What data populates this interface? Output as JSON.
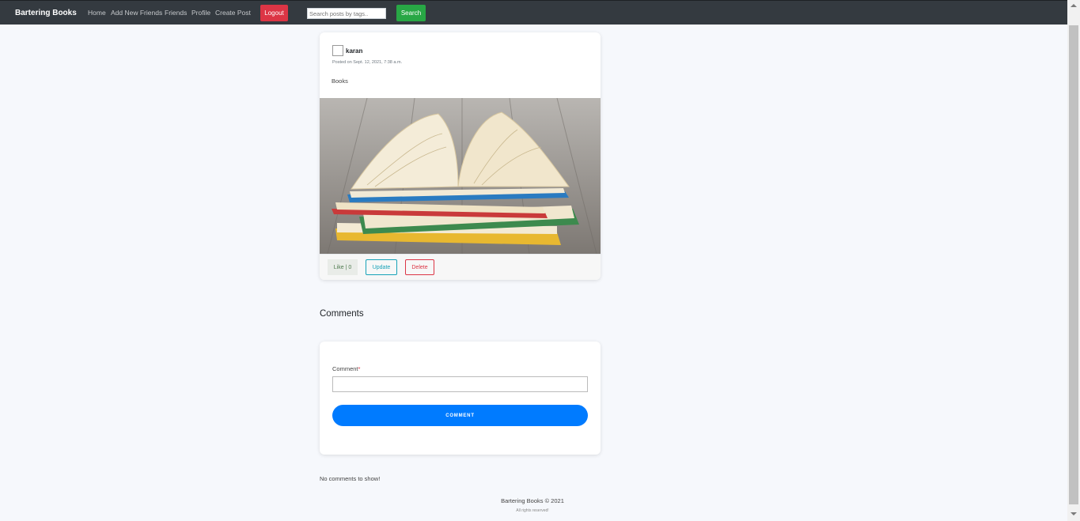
{
  "navbar": {
    "brand": "Bartering Books",
    "links": [
      "Home",
      "Add New Friends",
      "Friends",
      "Profile",
      "Create Post"
    ],
    "logout_label": "Logout",
    "search_placeholder": "Search posts by tags..",
    "search_label": "Search"
  },
  "post": {
    "author": "karan",
    "date": "Posted on Sept. 12, 2021, 7:38 a.m.",
    "text": "Books",
    "like_label": "Like | 0",
    "update_label": "Update",
    "delete_label": "Delete"
  },
  "comments": {
    "heading": "Comments",
    "field_label": "Comment",
    "required_mark": "*",
    "button_label": "COMMENT",
    "empty_text": "No comments to show!"
  },
  "footer": {
    "title": "Bartering Books © 2021",
    "subtitle": "All rights reserved!"
  },
  "colors": {
    "navbar_bg": "#343a40",
    "logout": "#dc3545",
    "search": "#28a745",
    "primary": "#007bff",
    "info": "#17a2b8"
  }
}
